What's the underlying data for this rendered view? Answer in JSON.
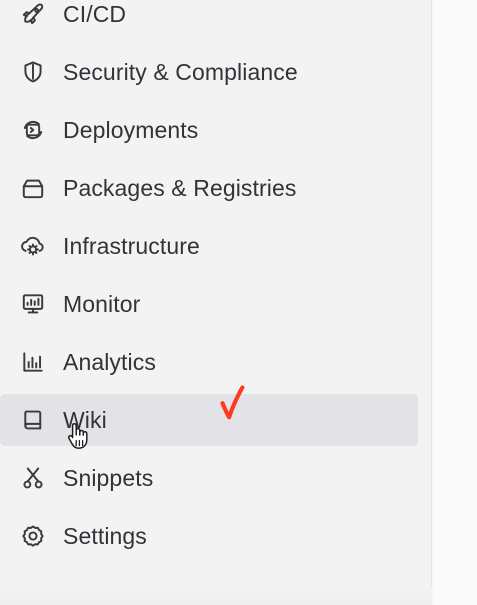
{
  "sidebar": {
    "items": [
      {
        "label": "CI/CD",
        "icon": "rocket-icon"
      },
      {
        "label": "Security & Compliance",
        "icon": "shield-icon"
      },
      {
        "label": "Deployments",
        "icon": "deployments-icon"
      },
      {
        "label": "Packages & Registries",
        "icon": "package-icon"
      },
      {
        "label": "Infrastructure",
        "icon": "infrastructure-icon"
      },
      {
        "label": "Monitor",
        "icon": "monitor-icon"
      },
      {
        "label": "Analytics",
        "icon": "analytics-icon"
      },
      {
        "label": "Wiki",
        "icon": "book-icon",
        "active": true
      },
      {
        "label": "Snippets",
        "icon": "scissors-icon"
      },
      {
        "label": "Settings",
        "icon": "gear-icon"
      }
    ]
  },
  "colors": {
    "sidebar_background": "#f3f3f4",
    "active_background": "#e3e2e7",
    "text": "#333238",
    "annotation": "#ff3b1f"
  }
}
